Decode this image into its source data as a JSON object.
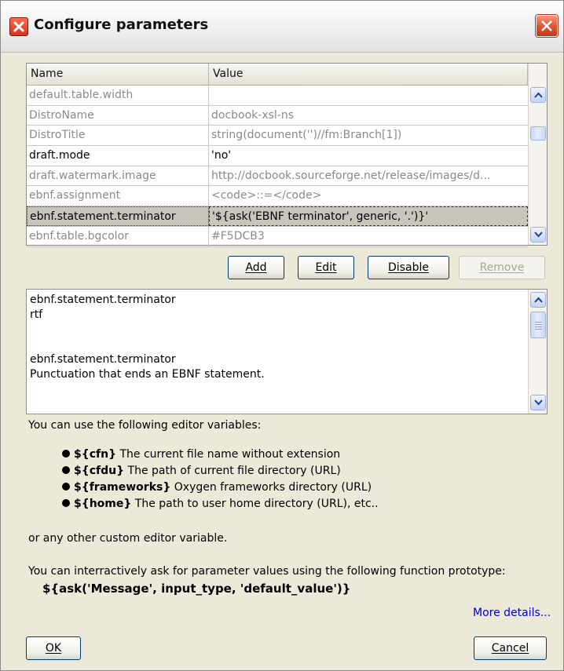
{
  "window": {
    "title": "Configure parameters"
  },
  "table": {
    "columns": {
      "name": "Name",
      "value": "Value"
    },
    "rows": [
      {
        "name": "default.table.width",
        "value": "",
        "state": "disabled"
      },
      {
        "name": "DistroName",
        "value": "docbook-xsl-ns",
        "state": "disabled"
      },
      {
        "name": "DistroTitle",
        "value": "string(document('')//fm:Branch[1])",
        "state": "disabled"
      },
      {
        "name": "draft.mode",
        "value": "'no'",
        "state": "enabled"
      },
      {
        "name": "draft.watermark.image",
        "value": "http://docbook.sourceforge.net/release/images/d...",
        "state": "disabled"
      },
      {
        "name": "ebnf.assignment",
        "value": "<code>::=</code>",
        "state": "disabled"
      },
      {
        "name": "ebnf.statement.terminator",
        "value": "'${ask('EBNF terminator', generic, '.')}'",
        "state": "selected"
      },
      {
        "name": "ebnf.table.bgcolor",
        "value": "#F5DCB3",
        "state": "disabled"
      }
    ]
  },
  "buttons": {
    "add": "Add",
    "edit": "Edit",
    "disable": "Disable",
    "remove": "Remove",
    "ok": "OK",
    "cancel": "Cancel"
  },
  "description": {
    "lines": [
      "ebnf.statement.terminator",
      "rtf",
      "",
      "",
      "ebnf.statement.terminator",
      "Punctuation that ends an EBNF statement."
    ]
  },
  "help": {
    "intro": "You can use the following editor variables:",
    "variables": [
      {
        "var": "${cfn}",
        "desc": " The current file name without extension"
      },
      {
        "var": "${cfdu}",
        "desc": " The path of current file directory (URL)"
      },
      {
        "var": "${frameworks}",
        "desc": " Oxygen frameworks directory (URL)"
      },
      {
        "var": "${home}",
        "desc": " The path to user home directory (URL), etc.."
      }
    ],
    "custom": "or any other custom editor variable.",
    "ask_intro": "You can interractively ask for parameter values using the following function prototype:",
    "prototype": "${ask('Message', input_type, 'default_value')}",
    "more_link": "More details..."
  },
  "colors": {
    "selected_row": "#c8c5bd",
    "disabled_text": "#8a8a8a",
    "link": "#0000cc",
    "dialog_bg": "#ece9d8"
  }
}
